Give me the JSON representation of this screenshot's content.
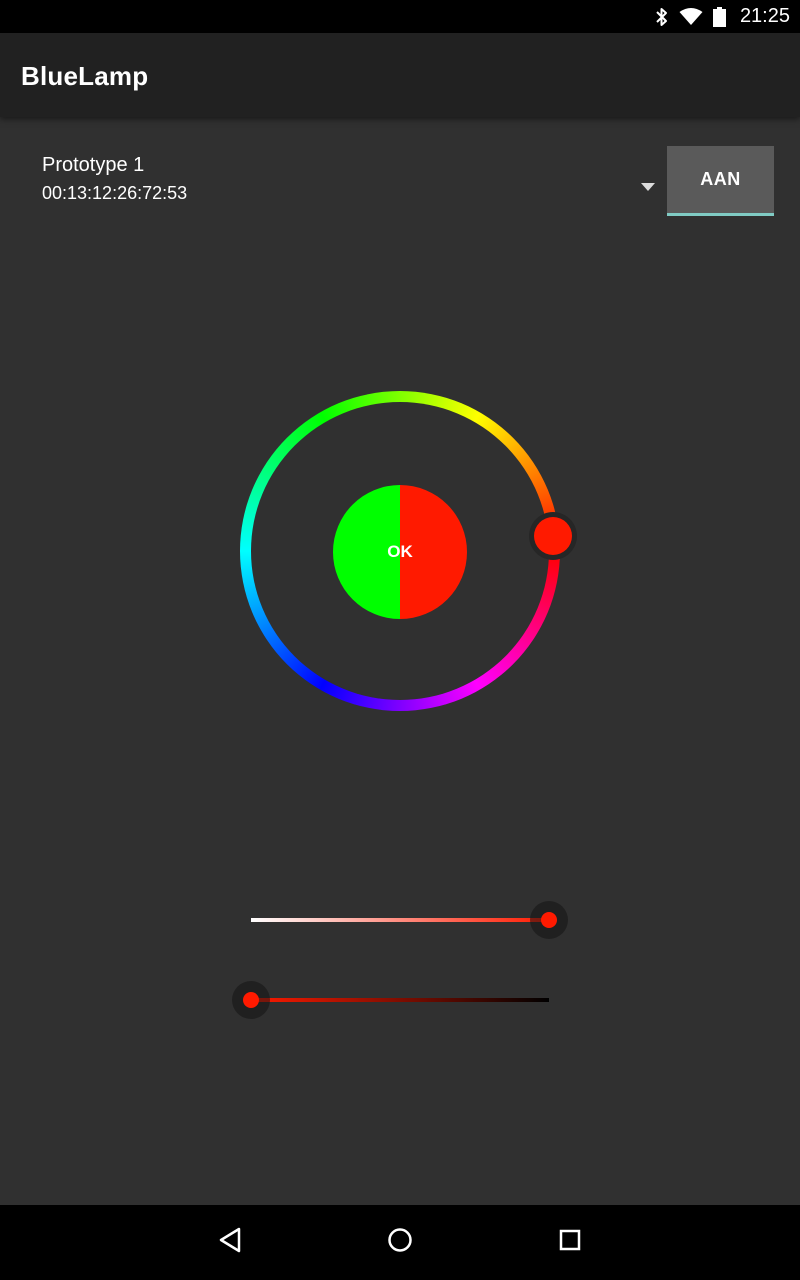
{
  "status_bar": {
    "time": "21:25",
    "icons": [
      "bluetooth-icon",
      "wifi-icon",
      "battery-icon"
    ]
  },
  "app_bar": {
    "title": "BlueLamp"
  },
  "device": {
    "name": "Prototype 1",
    "address": "00:13:12:26:72:53"
  },
  "toggle_button": {
    "label": "AAN"
  },
  "color_picker": {
    "center_label": "OK",
    "old_color": "#00ff00",
    "new_color": "#ff1a00",
    "hue_degrees": 5
  },
  "saturation_slider": {
    "value": 1.0,
    "start_color": "#ffffff",
    "end_color": "#ff1a00"
  },
  "value_slider": {
    "value": 0.0,
    "start_color": "#ff1a00",
    "end_color": "#000000"
  },
  "nav_bar": {
    "buttons": [
      "back-icon",
      "home-icon",
      "recents-icon"
    ]
  },
  "colors": {
    "background": "#303030",
    "app_bar": "#212121",
    "button": "#5a5a5a",
    "accent": "#80cbc4"
  }
}
